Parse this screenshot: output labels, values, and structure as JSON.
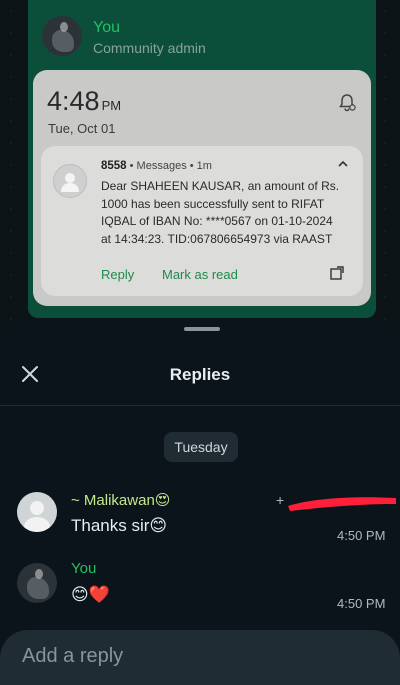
{
  "community_message": {
    "sender": "You",
    "role": "Community admin"
  },
  "notification_shade": {
    "time": "4:48",
    "ampm": "PM",
    "date": "Tue, Oct 01",
    "notification": {
      "sender": "8558",
      "meta": " • Messages • 1m",
      "body_lines": [
        "Dear SHAHEEN KAUSAR, an amount of Rs.",
        "1000 has been successfully sent to RIFAT",
        "IQBAL of IBAN No: ****0567 on 01-10-2024",
        "at 14:34:23. TID:067806654973 via RAAST"
      ],
      "actions": [
        "Reply",
        "Mark as read"
      ]
    }
  },
  "replies": {
    "title": "Replies",
    "date_chip": "Tuesday",
    "items": [
      {
        "name": "~ Malikawan😍",
        "name_color": "#c3e88d",
        "text": "Thanks sir😊",
        "time": "4:50 PM"
      },
      {
        "name": "You",
        "name_color": "#21c063",
        "text": "😊❤️",
        "time": "4:50 PM"
      }
    ],
    "input_placeholder": "Add a reply"
  },
  "colors": {
    "accent_green": "#21c063",
    "sheet_background": "#0b141a",
    "redaction": "#ff1f3a"
  },
  "icons": [
    "close-icon",
    "bell-settings-icon",
    "chevron-up-icon",
    "expand-icon",
    "person-icon"
  ]
}
